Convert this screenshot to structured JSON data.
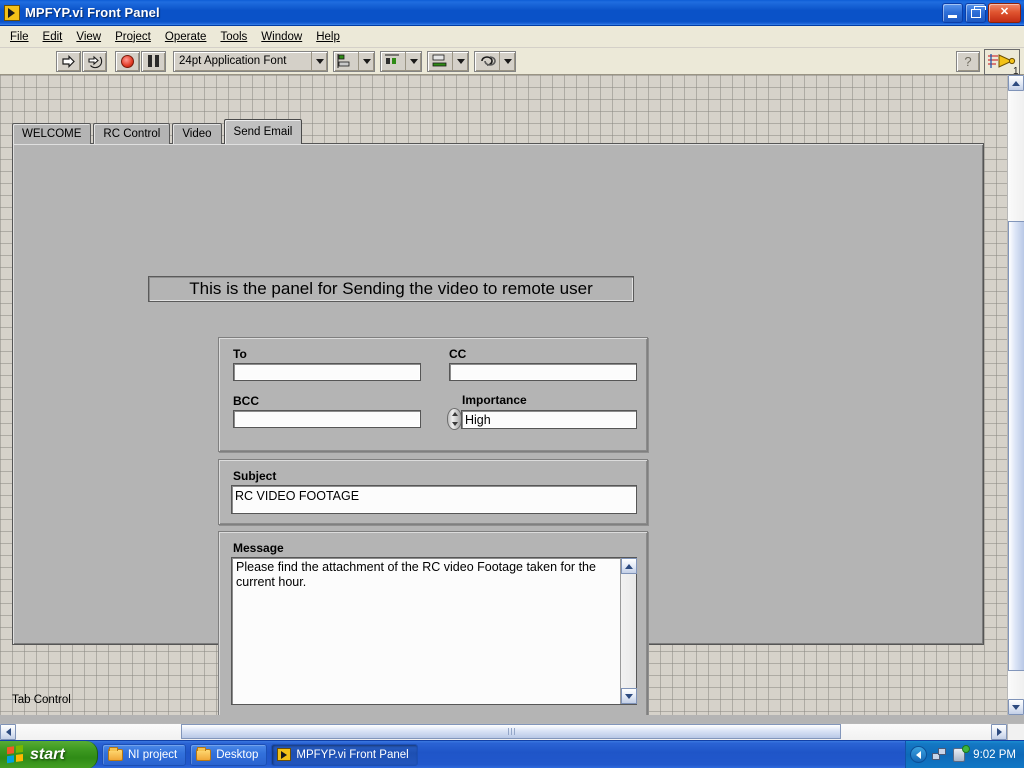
{
  "window": {
    "title": "MPFYP.vi Front Panel",
    "icon": "labview-vi-icon",
    "minimize_label": "",
    "restore_label": "",
    "close_label": "✕"
  },
  "menubar": {
    "items": [
      {
        "label": "File"
      },
      {
        "label": "Edit"
      },
      {
        "label": "View"
      },
      {
        "label": "Project"
      },
      {
        "label": "Operate"
      },
      {
        "label": "Tools"
      },
      {
        "label": "Window"
      },
      {
        "label": "Help"
      }
    ]
  },
  "toolbar": {
    "run_icon": "run-arrow-icon",
    "run_continuously_icon": "run-continuously-icon",
    "abort_icon": "abort-execution-icon",
    "pause_icon": "pause-icon",
    "font_selector": "24pt Application Font",
    "align_icon": "align-objects-icon",
    "distribute_icon": "distribute-objects-icon",
    "resize_icon": "resize-objects-icon",
    "reorder_icon": "reorder-objects-icon",
    "context_help_label": "?",
    "vi_icon_number": "1"
  },
  "tabs": {
    "items": [
      {
        "label": "WELCOME",
        "active": false
      },
      {
        "label": "RC Control",
        "active": false
      },
      {
        "label": "Video",
        "active": false
      },
      {
        "label": "Send Email",
        "active": true
      }
    ],
    "control_label": "Tab Control"
  },
  "panel": {
    "banner": "This is the panel for Sending the video to remote user",
    "recipients": {
      "to": {
        "label": "To",
        "value": ""
      },
      "cc": {
        "label": "CC",
        "value": ""
      },
      "bcc": {
        "label": "BCC",
        "value": ""
      },
      "importance": {
        "label": "Importance",
        "value": "High",
        "spinner_icon": "increment-decrement-icon"
      }
    },
    "subject": {
      "label": "Subject",
      "value": "RC VIDEO FOOTAGE"
    },
    "message": {
      "label": "Message",
      "value": "Please find the attachment of the RC video Footage taken for the current hour.",
      "scroll_up_icon": "chevron-up-icon",
      "scroll_down_icon": "chevron-down-icon"
    }
  },
  "scrollbars": {
    "v_up_icon": "chevron-up-icon",
    "v_down_icon": "chevron-down-icon",
    "h_left_icon": "chevron-left-icon",
    "h_right_icon": "chevron-right-icon"
  },
  "taskbar": {
    "start_label": "start",
    "items": [
      {
        "label": "NI project",
        "icon": "folder-icon",
        "active": false
      },
      {
        "label": "Desktop",
        "icon": "folder-icon",
        "active": false
      },
      {
        "label": "MPFYP.vi Front Panel",
        "icon": "labview-vi-icon",
        "active": true
      }
    ],
    "tray": {
      "expand_icon": "tray-expand-chevron-icon",
      "network_icon": "network-connections-icon",
      "device_icon": "removable-device-icon",
      "clock": "9:02 PM"
    }
  },
  "colors": {
    "title_blue": "#0a52c8",
    "panel_gray": "#b4b4b4",
    "canvas_gray": "#d6d2ca",
    "menu_beige": "#ece9d8",
    "field_white": "#fcfcfc",
    "taskbar_blue": "#1f55c8",
    "start_green": "#2f8b16",
    "close_red": "#c32d14"
  }
}
